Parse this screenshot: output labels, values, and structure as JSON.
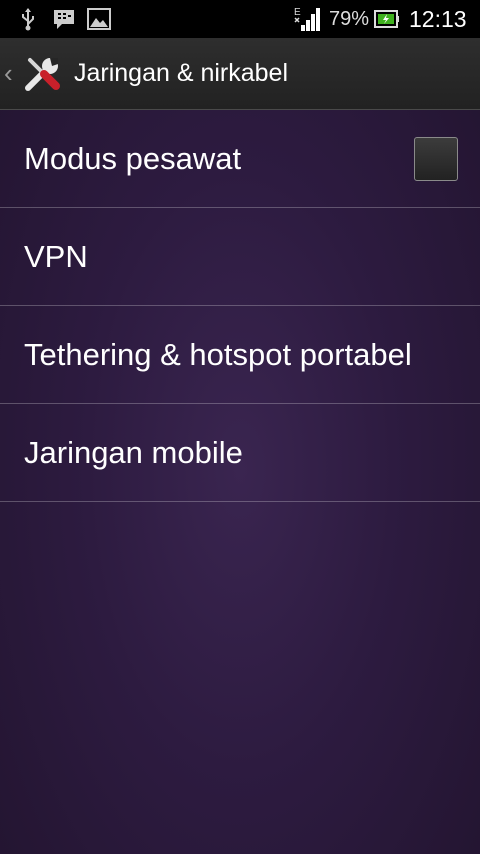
{
  "status_bar": {
    "icons": [
      "usb-icon",
      "bbm-icon",
      "gallery-icon",
      "signal-e-icon",
      "battery-charging-icon"
    ],
    "battery_percent": "79%",
    "time": "12:13",
    "network_type": "E"
  },
  "action_bar": {
    "title": "Jaringan & nirkabel",
    "back_icon": "chevron-left-icon",
    "app_icon": "tools-icon"
  },
  "settings": {
    "items": [
      {
        "label": "Modus pesawat",
        "checked": false
      },
      {
        "label": "VPN"
      },
      {
        "label": "Tethering & hotspot portabel"
      },
      {
        "label": "Jaringan mobile"
      }
    ]
  },
  "colors": {
    "background": "#2d1b40",
    "action_bar": "#262626",
    "status_bar": "#000000",
    "battery_green": "#3fb11e"
  }
}
